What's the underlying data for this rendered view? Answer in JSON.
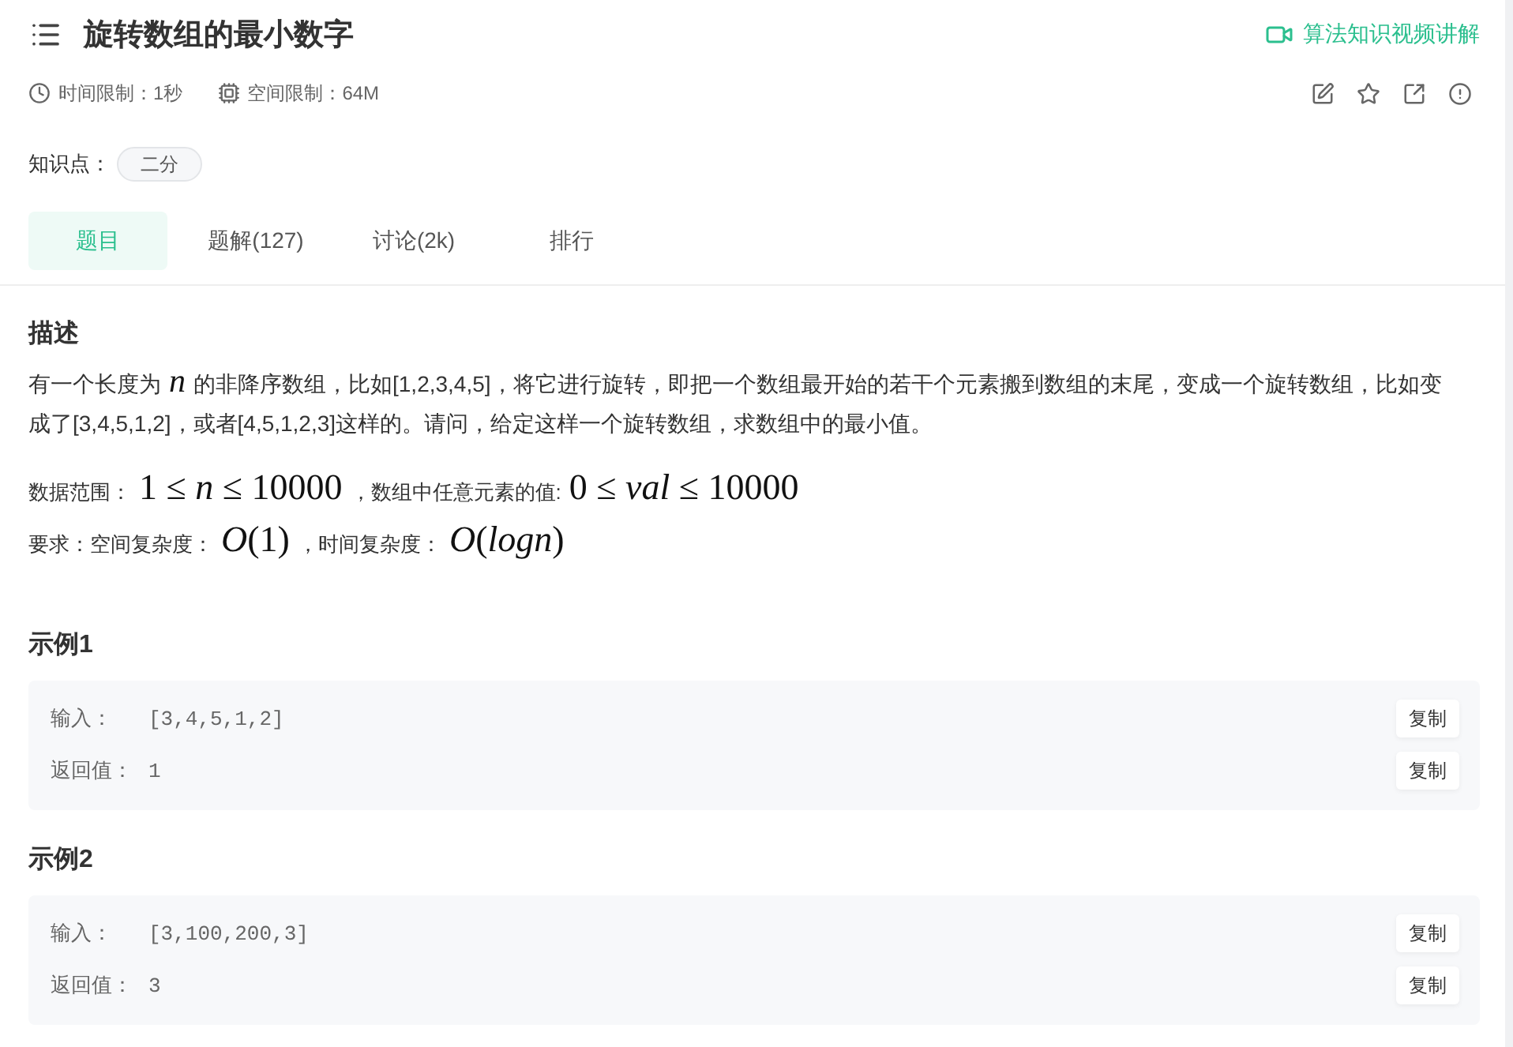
{
  "header": {
    "title": "旋转数组的最小数字",
    "video_link": "算法知识视频讲解"
  },
  "limits": [
    {
      "kind": "time",
      "text": "时间限制：1秒"
    },
    {
      "kind": "memory",
      "text": "空间限制：64M"
    }
  ],
  "knowledge": {
    "label": "知识点：",
    "tags": [
      "二分"
    ]
  },
  "tabs": [
    {
      "label": "题目",
      "selected": true
    },
    {
      "label": "题解(127)",
      "selected": false
    },
    {
      "label": "讨论(2k)",
      "selected": false
    },
    {
      "label": "排行",
      "selected": false
    }
  ],
  "description": {
    "heading": "描述",
    "paragraph": [
      {
        "kind": "text",
        "text": "有一个长度为"
      },
      {
        "kind": "math",
        "text": "*n*"
      },
      {
        "kind": "text",
        "text": "的非降序数组，比如[1,2,3,4,5]，将它进行旋转，即把一个数组最开始的若干个元素搬到数组的末尾，变成一个旋转数组，比如变成了[3,4,5,1,2]，或者[4,5,1,2,3]这样的。请问，给定这样一个旋转数组，求数组中的最小值。"
      }
    ],
    "constraints": [
      [
        {
          "kind": "text",
          "text": "数据范围："
        },
        {
          "kind": "math",
          "text": "1 ≤ *n* ≤ 10000"
        },
        {
          "kind": "text",
          "text": "，数组中任意元素的值:"
        },
        {
          "kind": "math",
          "text": "0 ≤ *val* ≤ 10000"
        }
      ],
      [
        {
          "kind": "text",
          "text": "要求：空间复杂度："
        },
        {
          "kind": "math",
          "text": "*O*(1)"
        },
        {
          "kind": "text",
          "text": "，时间复杂度："
        },
        {
          "kind": "math",
          "text": "*O*(*logn*)"
        }
      ]
    ]
  },
  "examples": [
    {
      "title": "示例1",
      "rows": [
        {
          "label": "输入：",
          "value": "[3,4,5,1,2]",
          "action": "复制"
        },
        {
          "label": "返回值：",
          "value": "1",
          "action": "复制"
        }
      ]
    },
    {
      "title": "示例2",
      "rows": [
        {
          "label": "输入：",
          "value": "[3,100,200,3]",
          "action": "复制"
        },
        {
          "label": "返回值：",
          "value": "3",
          "action": "复制"
        }
      ]
    }
  ]
}
